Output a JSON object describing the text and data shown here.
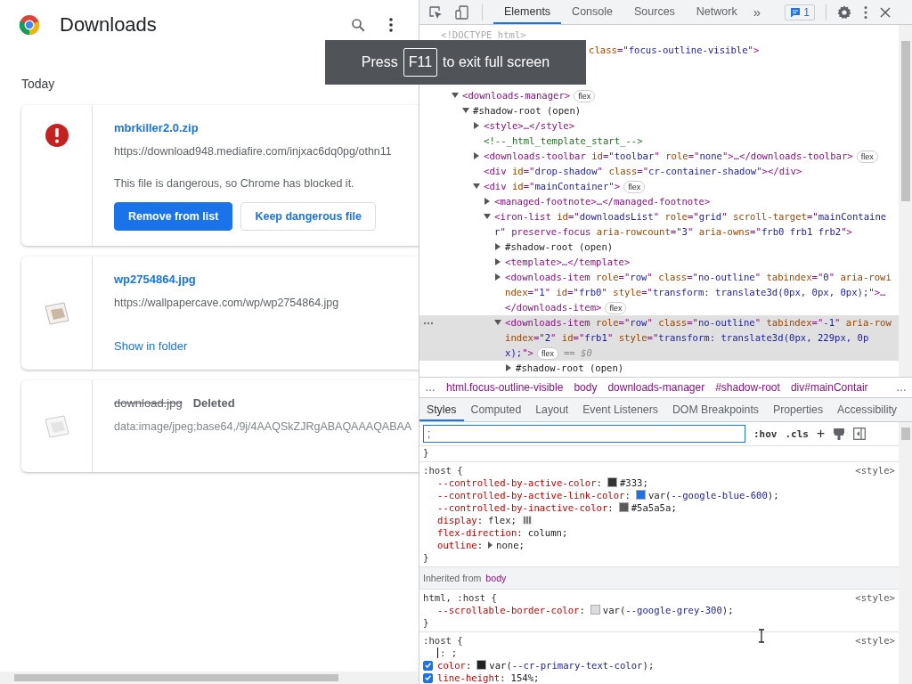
{
  "page": {
    "title": "Downloads",
    "section": "Today",
    "items": [
      {
        "kind": "dangerous",
        "name": "mbrkiller2.0.zip",
        "url": "https://download948.mediafire.com/injxac6dq0pg/othn11",
        "warning": "This file is dangerous, so Chrome has blocked it.",
        "buttons": [
          {
            "label": "Remove from list",
            "primary": true
          },
          {
            "label": "Keep dangerous file",
            "primary": false
          }
        ]
      },
      {
        "kind": "complete",
        "name": "wp2754864.jpg",
        "url": "https://wallpapercave.com/wp/wp2754864.jpg",
        "link": "Show in folder"
      },
      {
        "kind": "deleted",
        "name": "download.jpg",
        "status": "Deleted",
        "url": "data:image/jpeg;base64,/9j/4AAQSkZJRgABAQAAAQABAA"
      }
    ]
  },
  "toast": {
    "before": "Press",
    "key": "F11",
    "after": "to exit full screen"
  },
  "devtools": {
    "tabs": [
      {
        "label": "Elements",
        "selected": true
      },
      {
        "label": "Console",
        "selected": false
      },
      {
        "label": "Sources",
        "selected": false
      },
      {
        "label": "Network",
        "selected": false
      }
    ],
    "more_tabs": "»",
    "issues": "1",
    "tree": [
      {
        "kind": "doctype",
        "text": "<!DOCTYPE html>",
        "selected": false
      },
      {
        "kind": "element",
        "partial": true,
        "text": "class=\"focus-outline-visible\">",
        "selected": false,
        "children": [
          {
            "kind": "covered"
          },
          {
            "kind": "covered",
            "children": [
              {
                "kind": "element",
                "text": "<downloads-manager>",
                "badge": "flex",
                "expanded": true,
                "selected": false,
                "children": [
                  {
                    "kind": "shadow",
                    "text": "#shadow-root (open)",
                    "expanded": true,
                    "selected": false,
                    "children": [
                      {
                        "kind": "element",
                        "text": "<style>…</style>",
                        "expanded": false,
                        "selected": false
                      },
                      {
                        "kind": "comment",
                        "text": "<!--_html_template_start_-->",
                        "selected": false
                      },
                      {
                        "kind": "element",
                        "text": "<downloads-toolbar id=\"toolbar\" role=\"none\">…</downloads-toolbar>",
                        "badge": "flex",
                        "expanded": false,
                        "selected": false
                      },
                      {
                        "kind": "element",
                        "text": "<div id=\"drop-shadow\" class=\"cr-container-shadow\"></div>",
                        "selected": false
                      },
                      {
                        "kind": "element",
                        "text": "<div id=\"mainContainer\">",
                        "badge": "flex",
                        "expanded": true,
                        "selected": false,
                        "children": [
                          {
                            "kind": "element",
                            "text": "<managed-footnote>…</managed-footnote>",
                            "expanded": false,
                            "selected": false
                          },
                          {
                            "kind": "element",
                            "text": "<iron-list id=\"downloadsList\" role=\"grid\" scroll-target=\"mainContainer\" preserve-focus aria-rowcount=\"3\" aria-owns=\"frb0 frb1 frb2\">",
                            "expanded": true,
                            "selected": false,
                            "children": [
                              {
                                "kind": "shadow",
                                "text": "#shadow-root (open)",
                                "expanded": false,
                                "selected": false
                              },
                              {
                                "kind": "element",
                                "text": "<template>…</template>",
                                "expanded": false,
                                "selected": false
                              },
                              {
                                "kind": "element",
                                "text": "<downloads-item role=\"row\" class=\"no-outline\" tabindex=\"0\" aria-rowindex=\"1\" id=\"frb0\" style=\"transform: translate3d(0px, 0px, 0px);\">…</downloads-item>",
                                "badge": "flex",
                                "expanded": false,
                                "selected": false
                              },
                              {
                                "kind": "element",
                                "text": "<downloads-item role=\"row\" class=\"no-outline\" tabindex=\"-1\" aria-rowindex=\"2\" id=\"frb1\" style=\"transform: translate3d(0px, 229px, 0px);\">",
                                "badge": "flex",
                                "suffix": "== $0",
                                "expanded": true,
                                "selected": true,
                                "children": [
                                  {
                                    "kind": "shadow",
                                    "text": "#shadow-root (open)",
                                    "expanded": false,
                                    "selected": false
                                  }
                                ]
                              }
                            ]
                          }
                        ]
                      }
                    ]
                  }
                ]
              }
            ]
          }
        ]
      }
    ],
    "breadcrumbs": [
      {
        "label": "html.focus-outline-visible"
      },
      {
        "label": "body"
      },
      {
        "label": "downloads-manager"
      },
      {
        "label": "#shadow-root"
      },
      {
        "label": "div#mainContair"
      }
    ],
    "crumb_more": "…",
    "crumb_more_end": "…",
    "style_tabs": [
      {
        "label": "Styles",
        "selected": true
      },
      {
        "label": "Computed",
        "selected": false
      },
      {
        "label": "Layout",
        "selected": false
      },
      {
        "label": "Event Listeners",
        "selected": false
      },
      {
        "label": "DOM Breakpoints",
        "selected": false
      },
      {
        "label": "Properties",
        "selected": false
      },
      {
        "label": "Accessibility",
        "selected": false
      }
    ],
    "filter": {
      "value": ";"
    },
    "filter_buttons": [
      ":hov",
      ".cls",
      "+"
    ],
    "rules": [
      {
        "kind": "tail",
        "close": "}"
      },
      {
        "kind": "rule",
        "selector": ":host {",
        "source": "<style>",
        "close": "}",
        "decls": [
          {
            "kind": "decl",
            "name": "--controlled-by-active-color",
            "sep": ":",
            "value": "#333;",
            "color": "#333333"
          },
          {
            "kind": "decl",
            "name": "--controlled-by-active-link-color",
            "sep": ":",
            "value": "var(--google-blue-600);",
            "color": "#1a73e8"
          },
          {
            "kind": "decl",
            "name": "--controlled-by-inactive-color",
            "sep": ":",
            "value": "#5a5a5a;",
            "color": "#5a5a5a"
          },
          {
            "kind": "decl",
            "name": "display",
            "sep": ":",
            "value": "flex;",
            "flex_icon": true
          },
          {
            "kind": "decl",
            "name": "flex-direction",
            "sep": ":",
            "value": "column;"
          },
          {
            "kind": "decl",
            "name": "outline",
            "sep": ":",
            "value": "none;",
            "expandable": true
          }
        ]
      },
      {
        "kind": "inherited",
        "label": "Inherited from",
        "from": "body"
      },
      {
        "kind": "rule",
        "selector": "html, :host {",
        "source": "<style>",
        "close": "}",
        "decls": [
          {
            "kind": "decl",
            "name": "--scrollable-border-color",
            "sep": ":",
            "value": "var(--google-grey-300);",
            "color": "#dadce0"
          }
        ]
      },
      {
        "kind": "rule",
        "selector": ":host {",
        "source": "<style>",
        "decls": [
          {
            "kind": "editing",
            "text": ": ;"
          },
          {
            "kind": "decl",
            "name": "color",
            "sep": ":",
            "value": "var(--cr-primary-text-color);",
            "color": "#202124",
            "checked": true
          },
          {
            "kind": "decl",
            "name": "line-height",
            "sep": ":",
            "value": "154%;",
            "checked": true
          }
        ]
      }
    ]
  }
}
